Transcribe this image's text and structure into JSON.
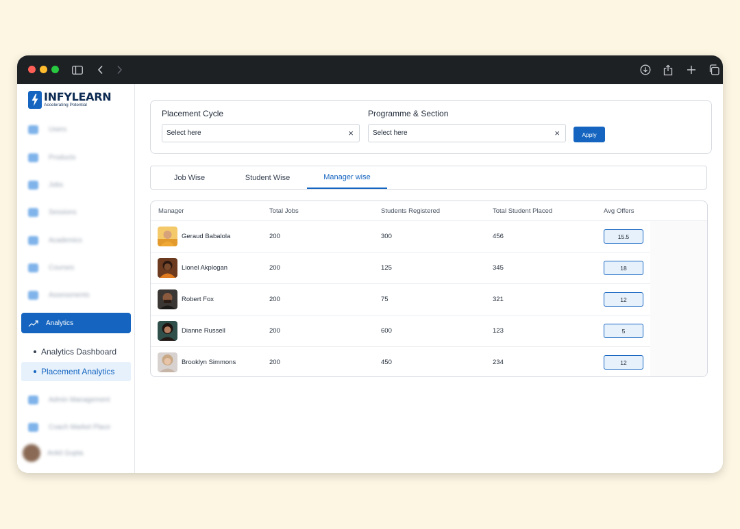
{
  "app": {
    "logo_name": "INFYLEARN",
    "logo_tagline": "Accelerating Potential"
  },
  "sidebar": {
    "items": [
      {
        "label": "Users",
        "icon": "users-icon"
      },
      {
        "label": "Products",
        "icon": "products-icon"
      },
      {
        "label": "Jobs",
        "icon": "jobs-icon"
      },
      {
        "label": "Sessions",
        "icon": "sessions-icon"
      },
      {
        "label": "Academics",
        "icon": "academics-icon"
      },
      {
        "label": "Courses",
        "icon": "courses-icon"
      },
      {
        "label": "Assessments",
        "icon": "assessments-icon"
      },
      {
        "label": "Analytics",
        "icon": "analytics-icon"
      },
      {
        "label": "Admin Management",
        "icon": "admin-icon"
      },
      {
        "label": "Coach Market Place",
        "icon": "coach-icon"
      }
    ],
    "subitems": [
      {
        "label": "Analytics Dashboard"
      },
      {
        "label": "Placement Analytics"
      }
    ],
    "profile_name": "Ankit Gupta"
  },
  "filters": {
    "placement_cycle_label": "Placement Cycle",
    "placement_cycle_value": "Select here",
    "programme_label": "Programme & Section",
    "programme_value": "Select here",
    "clear_symbol": "×",
    "apply_label": "Apply"
  },
  "tabs": [
    {
      "label": "Job Wise"
    },
    {
      "label": "Student Wise"
    },
    {
      "label": "Manager wise"
    }
  ],
  "table": {
    "headers": [
      "Manager",
      "Total Jobs",
      "Students Registered",
      "Total Student Placed",
      "Avg Offers"
    ],
    "rows": [
      {
        "manager": "Geraud Babalola",
        "total_jobs": "200",
        "students_registered": "300",
        "total_placed": "456",
        "avg_offers": "15.5"
      },
      {
        "manager": "Lionel Akplogan",
        "total_jobs": "200",
        "students_registered": "125",
        "total_placed": "345",
        "avg_offers": "18"
      },
      {
        "manager": "Robert Fox",
        "total_jobs": "200",
        "students_registered": "75",
        "total_placed": "321",
        "avg_offers": "12"
      },
      {
        "manager": "Dianne Russell",
        "total_jobs": "200",
        "students_registered": "600",
        "total_placed": "123",
        "avg_offers": "5"
      },
      {
        "manager": "Brooklyn Simmons",
        "total_jobs": "200",
        "students_registered": "450",
        "total_placed": "234",
        "avg_offers": "12"
      }
    ]
  },
  "colors": {
    "accent": "#1565c0",
    "page_background": "#fdf6e3",
    "titlebar": "#1e2124"
  }
}
